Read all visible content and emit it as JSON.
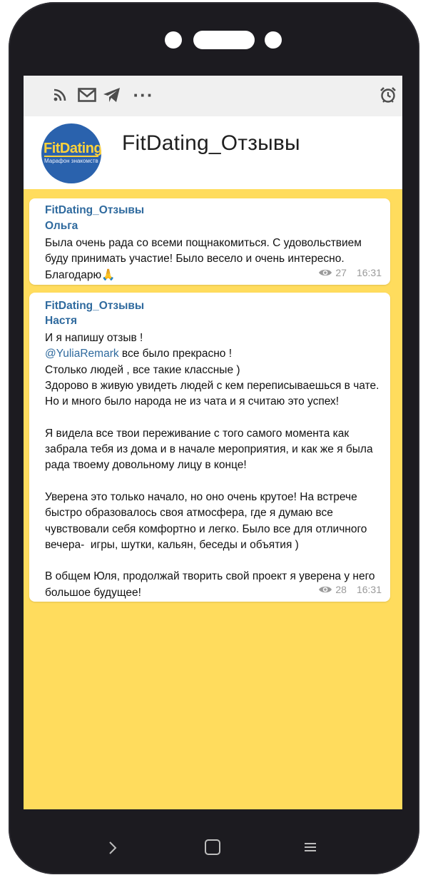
{
  "statusbar": {
    "icons": [
      "rss-icon",
      "mail-icon",
      "telegram-icon",
      "more-dots-icon",
      "alarm-icon"
    ],
    "more_label": "···"
  },
  "channel": {
    "title": "FitDating_Отзывы",
    "avatar_logo": "FitDating",
    "avatar_sub": "Марафон знакомств"
  },
  "messages": [
    {
      "channel": "FitDating_Отзывы",
      "author": "Ольга",
      "text": "Была очень рада со всеми пощнакомиться. С удовольствием буду принимать участие! Было весело и очень интересно. Благодарю🙏",
      "views": "27",
      "time": "16:31"
    },
    {
      "channel": "FitDating_Отзывы",
      "author": "Настя",
      "line1": "И я напишу отзыв !",
      "mention": "@YuliaRemark",
      "mention_rest": " все было прекрасно !",
      "text": "Столько людей , все такие классные )\nЗдорово в живую увидеть людей с кем переписываешься в чате.\nНо и много было народа не из чата и я считаю это успех!\n\nЯ видела все твои переживание с того самого момента как забрала тебя из дома и в начале мероприятия, и как же я была рада твоему довольному лицу в конце!\n\nУверена это только начало, но оно очень крутое! На встрече быстро образовалось своя атмосфера, где я думаю все чувствовали себя комфортно и легко. Было все для отличного вечера-  игры, шутки, кальян, беседы и объятия )\n\nВ общем Юля, продолжай творить свой проект я уверена у него большое будущее!",
      "views": "28",
      "time": "16:31"
    }
  ],
  "colors": {
    "chat_background": "#ffdc5d",
    "link": "#2f6a9e",
    "phone_frame": "#1c1b20"
  },
  "navbar": {
    "icons": [
      "back-icon",
      "home-icon",
      "menu-icon"
    ]
  }
}
